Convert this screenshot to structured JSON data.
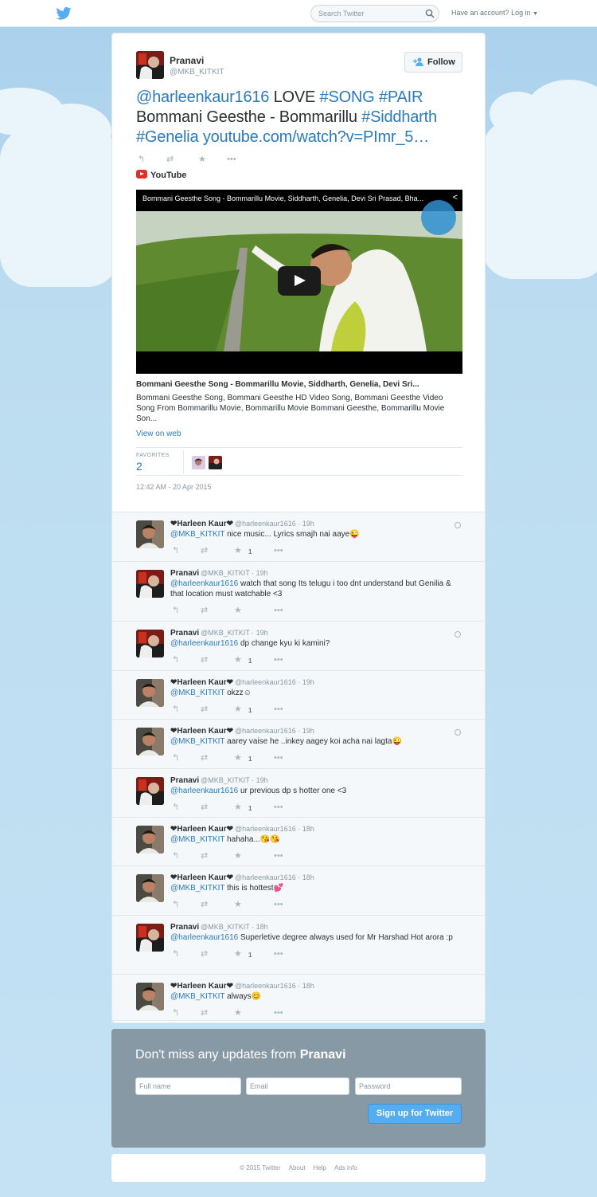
{
  "topbar": {
    "search_placeholder": "Search Twitter",
    "account_text": "Have an account?",
    "login_label": "Log in"
  },
  "tweet": {
    "author_name": "Pranavi",
    "author_handle": "@MKB_KITKIT",
    "follow_label": "Follow",
    "text_parts": {
      "mention": "@harleenkaur1616",
      "love": " LOVE ",
      "tag_song": "#SONG",
      "space1": " ",
      "tag_pair": "#PAIR",
      "plain": " Bommani Geesthe - Bommarillu ",
      "tag_siddharth": "#Siddharth",
      "space2": " ",
      "tag_genelia": "#Genelia",
      "space3": " ",
      "link": "youtube.com/watch?v=PImr_5…"
    },
    "source_label": "YouTube",
    "video_title": "Bommani Geesthe Song - Bommarillu Movie, Siddharth, Genelia, Devi Sri Prasad, Bha...",
    "card_title": "Bommani Geesthe Song - Bommarillu Movie, Siddharth, Genelia, Devi Sri...",
    "card_description": "Bommani Geesthe Song, Bommani Geesthe HD Video Song, Bommani Geesthe Video Song From Bommarillu Movie, Bommarillu Movie Bommani Geesthe, Bommarillu Movie Son...",
    "view_on_web": "View on web",
    "favorites_label": "FAVORITES",
    "favorites_count": "2",
    "timestamp": "12:42 AM - 20 Apr 2015"
  },
  "icons": {
    "reply": "reply-icon",
    "retweet": "retweet-icon",
    "favorite": "star-icon",
    "more": "more-icon"
  },
  "replies": [
    {
      "name": "❤Harleen Kaur❤",
      "handle": "@harleenkaur1616 · 19h",
      "mention": "@MKB_KITKIT",
      "text": "  nice music... Lyrics smajh nai aaye😜",
      "fav": "1",
      "ctx": true
    },
    {
      "name": "Pranavi",
      "handle": "@MKB_KITKIT · 19h",
      "mention": "@harleenkaur1616",
      "text": " watch that song Its telugu i too dnt understand but Genilia & that location must watchable <3",
      "fav": "",
      "ctx": false
    },
    {
      "name": "Pranavi",
      "handle": "@MKB_KITKIT · 19h",
      "mention": "@harleenkaur1616",
      "text": " dp change kyu ki kamini?",
      "fav": "1",
      "ctx": true
    },
    {
      "name": "❤Harleen Kaur❤",
      "handle": "@harleenkaur1616 · 19h",
      "mention": "@MKB_KITKIT",
      "text": " okzz☺",
      "fav": "1",
      "ctx": false
    },
    {
      "name": "❤Harleen Kaur❤",
      "handle": "@harleenkaur1616 · 19h",
      "mention": "@MKB_KITKIT",
      "text": " aarey vaise he ..inkey aagey koi acha nai lagta😜",
      "fav": "1",
      "ctx": true
    },
    {
      "name": "Pranavi",
      "handle": "@MKB_KITKIT · 19h",
      "mention": "@harleenkaur1616",
      "text": " ur previous dp s hotter one <3",
      "fav": "1",
      "ctx": false
    },
    {
      "name": "❤Harleen Kaur❤",
      "handle": "@harleenkaur1616 · 18h",
      "mention": "@MKB_KITKIT",
      "text": " hahaha...😘😘",
      "fav": "",
      "ctx": false
    },
    {
      "name": "❤Harleen Kaur❤",
      "handle": "@harleenkaur1616 · 18h",
      "mention": "@MKB_KITKIT",
      "text": " this is hottest💕",
      "fav": "",
      "ctx": false
    },
    {
      "name": "Pranavi",
      "handle": "@MKB_KITKIT · 18h",
      "mention": "@harleenkaur1616",
      "text": " Superletive degree always used for Mr Harshad Hot arora :p",
      "fav": "1",
      "ctx": false
    },
    {
      "name": "❤Harleen Kaur❤",
      "handle": "@harleenkaur1616 · 18h",
      "mention": "@MKB_KITKIT",
      "text": " always😊",
      "fav": "",
      "ctx": false
    }
  ],
  "signup": {
    "heading_prefix": "Don't miss any updates from ",
    "heading_name": "Pranavi",
    "fullname_placeholder": "Full name",
    "email_placeholder": "Email",
    "password_placeholder": "Password",
    "button_label": "Sign up for Twitter"
  },
  "footer": {
    "copyright": "© 2015 Twitter",
    "about": "About",
    "help": "Help",
    "ads": "Ads info"
  },
  "colors": {
    "accent": "#2b7bb9",
    "signup_bg": "#8899a6",
    "button": "#55acee"
  }
}
